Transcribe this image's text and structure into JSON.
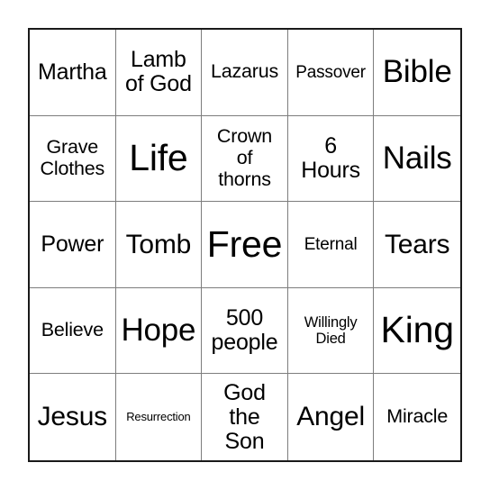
{
  "card": {
    "type": "bingo-card",
    "rows": 5,
    "columns": 5,
    "border_color": "#1a1a1a",
    "gridline_color": "#7d7d7d",
    "background_color": "#ffffff",
    "text_color": "#000000",
    "cells": [
      [
        {
          "text": "Martha",
          "size": "lg"
        },
        {
          "text": "Lamb\nof God",
          "size": "lg"
        },
        {
          "text": "Lazarus",
          "size": "md"
        },
        {
          "text": "Passover",
          "size": "smd"
        },
        {
          "text": "Bible",
          "size": "xxl"
        }
      ],
      [
        {
          "text": "Grave\nClothes",
          "size": "md"
        },
        {
          "text": "Life",
          "size": "huge"
        },
        {
          "text": "Crown\nof\nthorns",
          "size": "md"
        },
        {
          "text": "6\nHours",
          "size": "lg"
        },
        {
          "text": "Nails",
          "size": "xxl"
        }
      ],
      [
        {
          "text": "Power",
          "size": "lg"
        },
        {
          "text": "Tomb",
          "size": "xl"
        },
        {
          "text": "Free",
          "size": "huge"
        },
        {
          "text": "Eternal",
          "size": "smd"
        },
        {
          "text": "Tears",
          "size": "xl"
        }
      ],
      [
        {
          "text": "Believe",
          "size": "md"
        },
        {
          "text": "Hope",
          "size": "xxl"
        },
        {
          "text": "500\npeople",
          "size": "lg"
        },
        {
          "text": "Willingly\nDied",
          "size": "sm"
        },
        {
          "text": "King",
          "size": "huge"
        }
      ],
      [
        {
          "text": "Jesus",
          "size": "xl"
        },
        {
          "text": "Resurrection",
          "size": "xs"
        },
        {
          "text": "God\nthe\nSon",
          "size": "lg"
        },
        {
          "text": "Angel",
          "size": "xl"
        },
        {
          "text": "Miracle",
          "size": "md"
        }
      ]
    ]
  }
}
